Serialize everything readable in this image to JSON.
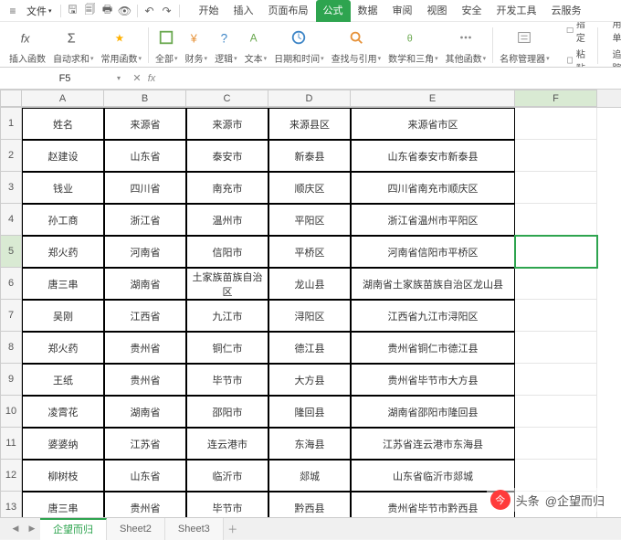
{
  "menubar": {
    "file_label": "文件",
    "tabs": [
      "开始",
      "插入",
      "页面布局",
      "公式",
      "数据",
      "审阅",
      "视图",
      "安全",
      "开发工具",
      "云服务"
    ],
    "active_tab_index": 3
  },
  "ribbon": {
    "groups": [
      {
        "label": "插入函数"
      },
      {
        "label": "自动求和"
      },
      {
        "label": "常用函数"
      },
      {
        "label": "全部"
      },
      {
        "label": "财务"
      },
      {
        "label": "逻辑"
      },
      {
        "label": "文本"
      },
      {
        "label": "日期和时间"
      },
      {
        "label": "查找与引用"
      },
      {
        "label": "数学和三角"
      },
      {
        "label": "其他函数"
      },
      {
        "label": "名称管理器"
      }
    ],
    "right": {
      "paste": "粘贴",
      "define": "指定",
      "trace_precedents": "追踪引用单",
      "trace_dependents": "追踪从属单"
    }
  },
  "fxbar": {
    "namebox_value": "F5",
    "formula_value": ""
  },
  "columns": [
    "A",
    "B",
    "C",
    "D",
    "E",
    "F"
  ],
  "selected_cell": {
    "col": 5,
    "row": 5
  },
  "table": {
    "headers": [
      "姓名",
      "来源省",
      "来源市",
      "来源县区",
      "来源省市区"
    ],
    "rows": [
      [
        "赵建设",
        "山东省",
        "泰安市",
        "新泰县",
        "山东省泰安市新泰县"
      ],
      [
        "钱业",
        "四川省",
        "南充市",
        "顺庆区",
        "四川省南充市顺庆区"
      ],
      [
        "孙工商",
        "浙江省",
        "温州市",
        "平阳区",
        "浙江省温州市平阳区"
      ],
      [
        "郑火药",
        "河南省",
        "信阳市",
        "平桥区",
        "河南省信阳市平桥区"
      ],
      [
        "唐三串",
        "湖南省",
        "土家族苗族自治区",
        "龙山县",
        "湖南省土家族苗族自治区龙山县"
      ],
      [
        "吴刚",
        "江西省",
        "九江市",
        "浔阳区",
        "江西省九江市浔阳区"
      ],
      [
        "郑火药",
        "贵州省",
        "铜仁市",
        "德江县",
        "贵州省铜仁市德江县"
      ],
      [
        "王纸",
        "贵州省",
        "毕节市",
        "大方县",
        "贵州省毕节市大方县"
      ],
      [
        "凌霄花",
        "湖南省",
        "邵阳市",
        "隆回县",
        "湖南省邵阳市隆回县"
      ],
      [
        "婆婆纳",
        "江苏省",
        "连云港市",
        "东海县",
        "江苏省连云港市东海县"
      ],
      [
        "柳树枝",
        "山东省",
        "临沂市",
        "郯城",
        "山东省临沂市郯城"
      ],
      [
        "唐三串",
        "贵州省",
        "毕节市",
        "黔西县",
        "贵州省毕节市黔西县"
      ]
    ]
  },
  "sheets": {
    "tabs": [
      "企望而归",
      "Sheet2",
      "Sheet3"
    ],
    "active_index": 0
  },
  "watermark": {
    "prefix": "头条",
    "handle": "@企望而归"
  }
}
